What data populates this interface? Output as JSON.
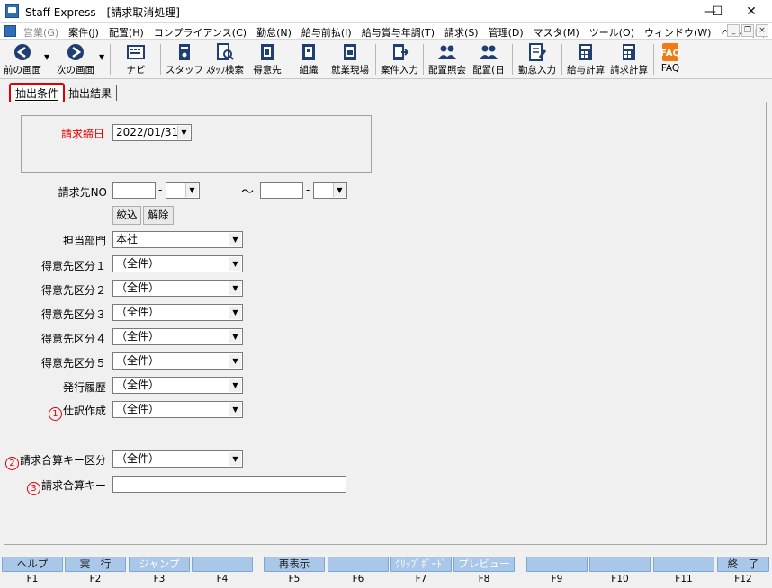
{
  "window": {
    "title": "Staff Express - [請求取消処理]",
    "minimize": "—",
    "maximize": "☐",
    "close": "✕"
  },
  "menubar": {
    "items": [
      {
        "label": "営業(G)",
        "enabled": false
      },
      {
        "label": "案件(J)",
        "enabled": true
      },
      {
        "label": "配置(H)",
        "enabled": true
      },
      {
        "label": "コンプライアンス(C)",
        "enabled": true
      },
      {
        "label": "勤怠(N)",
        "enabled": true
      },
      {
        "label": "給与前払(I)",
        "enabled": true
      },
      {
        "label": "給与賞与年調(T)",
        "enabled": true
      },
      {
        "label": "請求(S)",
        "enabled": true
      },
      {
        "label": "管理(D)",
        "enabled": true
      },
      {
        "label": "マスタ(M)",
        "enabled": true
      },
      {
        "label": "ツール(O)",
        "enabled": true
      },
      {
        "label": "ウィンドウ(W)",
        "enabled": true
      },
      {
        "label": "ヘルプ(H)",
        "enabled": true
      }
    ],
    "mdi_minimize": "_",
    "mdi_restore": "❐",
    "mdi_close": "×"
  },
  "toolbar": {
    "back": "前の画面",
    "forward": "次の画面",
    "navi": "ナビ",
    "staff": "スタッフ",
    "staff_search": "ｽﾀｯﾌ検索",
    "client": "得意先",
    "org": "組織",
    "site": "就業現場",
    "case_input": "案件入力",
    "assign_inquiry": "配置照会",
    "assign_day": "配置(日",
    "attendance_input": "勤怠入力",
    "payroll_calc": "給与計算",
    "billing_calc": "請求計算",
    "faq": "FAQ"
  },
  "tabs": {
    "active": "抽出条件",
    "inactive": "抽出結果"
  },
  "form": {
    "billing_close_date": {
      "label": "請求締日",
      "value": "2022/01/31"
    },
    "billing_no": {
      "label": "請求先NO",
      "dash": "-",
      "tilde": "～"
    },
    "filter_button": "絞込",
    "clear_button": "解除",
    "department": {
      "label": "担当部門",
      "value": "本社"
    },
    "client_cat1": {
      "label": "得意先区分１",
      "value": "（全件）"
    },
    "client_cat2": {
      "label": "得意先区分２",
      "value": "（全件）"
    },
    "client_cat3": {
      "label": "得意先区分３",
      "value": "（全件）"
    },
    "client_cat4": {
      "label": "得意先区分４",
      "value": "（全件）"
    },
    "client_cat5": {
      "label": "得意先区分５",
      "value": "（全件）"
    },
    "issue_history": {
      "label": "発行履歴",
      "value": "（全件）"
    },
    "journal": {
      "marker": "1",
      "label": "仕訳作成",
      "value": "（全件）"
    },
    "merge_key_type": {
      "marker": "2",
      "label": "請求合算キー区分",
      "value": "（全件）"
    },
    "merge_key": {
      "marker": "3",
      "label": "請求合算キー",
      "value": ""
    }
  },
  "fkeys": [
    {
      "label": "ヘルプ",
      "key": "F1",
      "enabled": true
    },
    {
      "label": "実　行",
      "key": "F2",
      "enabled": true
    },
    {
      "label": "ジャンプ",
      "key": "F3",
      "enabled": false
    },
    {
      "label": "",
      "key": "F4",
      "enabled": false
    },
    {
      "label": "再表示",
      "key": "F5",
      "enabled": true
    },
    {
      "label": "",
      "key": "F6",
      "enabled": false
    },
    {
      "label": "ｸﾘｯﾌﾟﾎﾞｰﾄﾞ",
      "key": "F7",
      "enabled": false
    },
    {
      "label": "プレビュー",
      "key": "F8",
      "enabled": false
    },
    {
      "label": "",
      "key": "F9",
      "enabled": false
    },
    {
      "label": "",
      "key": "F10",
      "enabled": false
    },
    {
      "label": "",
      "key": "F11",
      "enabled": false
    },
    {
      "label": "終　了",
      "key": "F12",
      "enabled": true
    }
  ],
  "colors": {
    "accent_red": "#e00000",
    "fkey_blue": "#a9c7e8",
    "icon_navy": "#1f3f73"
  }
}
